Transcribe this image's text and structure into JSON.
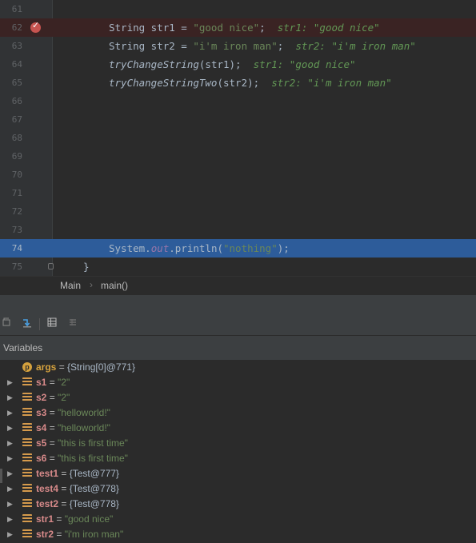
{
  "editor": {
    "lines": [
      {
        "num": "61",
        "code": ""
      },
      {
        "num": "62",
        "code": "String str1 = ",
        "str": "\"good nice\"",
        "tail": ";",
        "hint": "str1: \"good nice\""
      },
      {
        "num": "63",
        "code": "String str2 = ",
        "str": "\"i'm iron man\"",
        "tail": ";",
        "hint": "str2: \"i'm iron man\""
      },
      {
        "num": "64",
        "fn": "tryChangeString",
        "args": "(str1);",
        "hint": "str1: \"good nice\""
      },
      {
        "num": "65",
        "fn": "tryChangeStringTwo",
        "args": "(str2);",
        "hint": "str2: \"i'm iron man\""
      },
      {
        "num": "66"
      },
      {
        "num": "67"
      },
      {
        "num": "68"
      },
      {
        "num": "69"
      },
      {
        "num": "70"
      },
      {
        "num": "71"
      },
      {
        "num": "72"
      },
      {
        "num": "73"
      },
      {
        "num": "74",
        "prefix": "System.",
        "field": "out",
        "mid": ".println(",
        "str": "\"nothing\"",
        "tail": ");"
      },
      {
        "num": "75",
        "brace": "}"
      }
    ]
  },
  "breadcrumb": {
    "class_name": "Main",
    "separator": "›",
    "method_name": "main()"
  },
  "toolbar": {
    "icons": [
      "restore-layout-icon",
      "step-into-icon",
      "table-view-icon",
      "watches-icon"
    ]
  },
  "variables": {
    "title": "Variables",
    "items": [
      {
        "name": "args",
        "eq": " = ",
        "value": "{String[0]@771}",
        "kind": "param",
        "vtype": "obj",
        "icon_letter": "p"
      },
      {
        "name": "s1",
        "eq": " = ",
        "value": "\"2\"",
        "kind": "field",
        "vtype": "str"
      },
      {
        "name": "s2",
        "eq": " = ",
        "value": "\"2\"",
        "kind": "field",
        "vtype": "str"
      },
      {
        "name": "s3",
        "eq": " = ",
        "value": "\"helloworld!\"",
        "kind": "field",
        "vtype": "str"
      },
      {
        "name": "s4",
        "eq": " = ",
        "value": "\"helloworld!\"",
        "kind": "field",
        "vtype": "str"
      },
      {
        "name": "s5",
        "eq": " = ",
        "value": "\"this is first time\"",
        "kind": "field",
        "vtype": "str"
      },
      {
        "name": "s6",
        "eq": " = ",
        "value": "\"this is first time\"",
        "kind": "field",
        "vtype": "str"
      },
      {
        "name": "test1",
        "eq": " = ",
        "value": "{Test@777}",
        "kind": "field",
        "vtype": "obj"
      },
      {
        "name": "test4",
        "eq": " = ",
        "value": "{Test@778}",
        "kind": "field",
        "vtype": "obj"
      },
      {
        "name": "test2",
        "eq": " = ",
        "value": "{Test@778}",
        "kind": "field",
        "vtype": "obj"
      },
      {
        "name": "str1",
        "eq": " = ",
        "value": "\"good nice\"",
        "kind": "field",
        "vtype": "str"
      },
      {
        "name": "str2",
        "eq": " = ",
        "value": "\"i'm iron man\"",
        "kind": "field",
        "vtype": "str"
      }
    ]
  },
  "colors": {
    "breakpoint": "#c75450",
    "execution_line": "#2d5c9a",
    "string": "#6a8759",
    "variable_name": "#d88a8a"
  }
}
